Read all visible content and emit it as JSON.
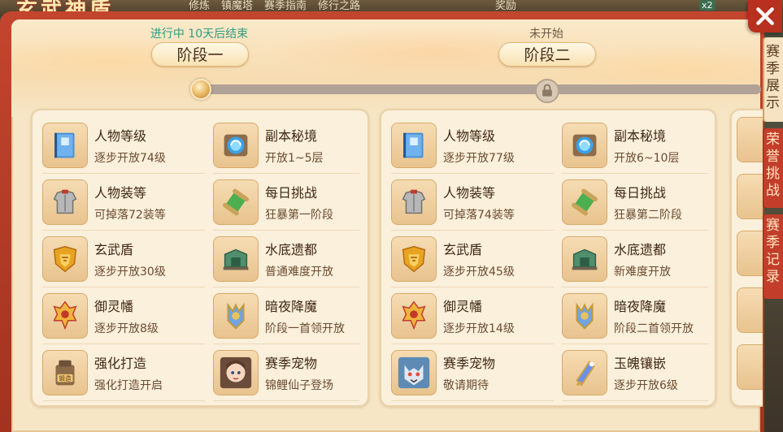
{
  "header": {
    "title": "玄武神盾",
    "nav": [
      "修炼",
      "镇魔塔",
      "赛季指南",
      "修行之路"
    ],
    "reward": "奖励",
    "badge": "x2"
  },
  "side_tabs": [
    {
      "label": "赛季展示",
      "active": true
    },
    {
      "label": "荣誉挑战",
      "active": false
    },
    {
      "label": "赛季记录",
      "active": false
    }
  ],
  "stages": [
    {
      "status": "进行中 10天后结束",
      "title": "阶段一",
      "items": [
        {
          "icon": "skill-book-icon",
          "name": "人物等级",
          "desc": "逐步开放74级"
        },
        {
          "icon": "portal-icon",
          "name": "副本秘境",
          "desc": "开放1~5层"
        },
        {
          "icon": "armor-icon",
          "name": "人物装等",
          "desc": "可掉落72装等"
        },
        {
          "icon": "scroll-icon",
          "name": "每日挑战",
          "desc": "狂暴第一阶段"
        },
        {
          "icon": "shield-icon",
          "name": "玄武盾",
          "desc": "逐步开放30级"
        },
        {
          "icon": "ruins-icon",
          "name": "水底遗都",
          "desc": "普通难度开放"
        },
        {
          "icon": "banner-icon",
          "name": "御灵幡",
          "desc": "逐步开放8级"
        },
        {
          "icon": "demon-icon",
          "name": "暗夜降魔",
          "desc": "阶段一首领开放"
        },
        {
          "icon": "forge-icon",
          "name": "强化打造",
          "desc": "强化打造开启"
        },
        {
          "icon": "fairy-pet-icon",
          "name": "赛季宠物",
          "desc": "锦鲤仙子登场"
        }
      ]
    },
    {
      "status": "未开始",
      "title": "阶段二",
      "items": [
        {
          "icon": "skill-book-icon",
          "name": "人物等级",
          "desc": "逐步开放77级"
        },
        {
          "icon": "portal-icon",
          "name": "副本秘境",
          "desc": "开放6~10层"
        },
        {
          "icon": "armor-icon",
          "name": "人物装等",
          "desc": "可掉落74装等"
        },
        {
          "icon": "scroll-icon",
          "name": "每日挑战",
          "desc": "狂暴第二阶段"
        },
        {
          "icon": "shield-icon",
          "name": "玄武盾",
          "desc": "逐步开放45级"
        },
        {
          "icon": "ruins-icon",
          "name": "水底遗都",
          "desc": "新难度开放"
        },
        {
          "icon": "banner-icon",
          "name": "御灵幡",
          "desc": "逐步开放14级"
        },
        {
          "icon": "demon-icon",
          "name": "暗夜降魔",
          "desc": "阶段二首领开放"
        },
        {
          "icon": "wolf-pet-icon",
          "name": "赛季宠物",
          "desc": "敬请期待"
        },
        {
          "icon": "gem-icon",
          "name": "玉魄镶嵌",
          "desc": "逐步开放6级"
        }
      ]
    }
  ],
  "colors": {
    "frame": "#b8301f",
    "panel": "#fbf0dc",
    "status_active": "#2d9d85",
    "status_pending": "#6b5a48"
  }
}
